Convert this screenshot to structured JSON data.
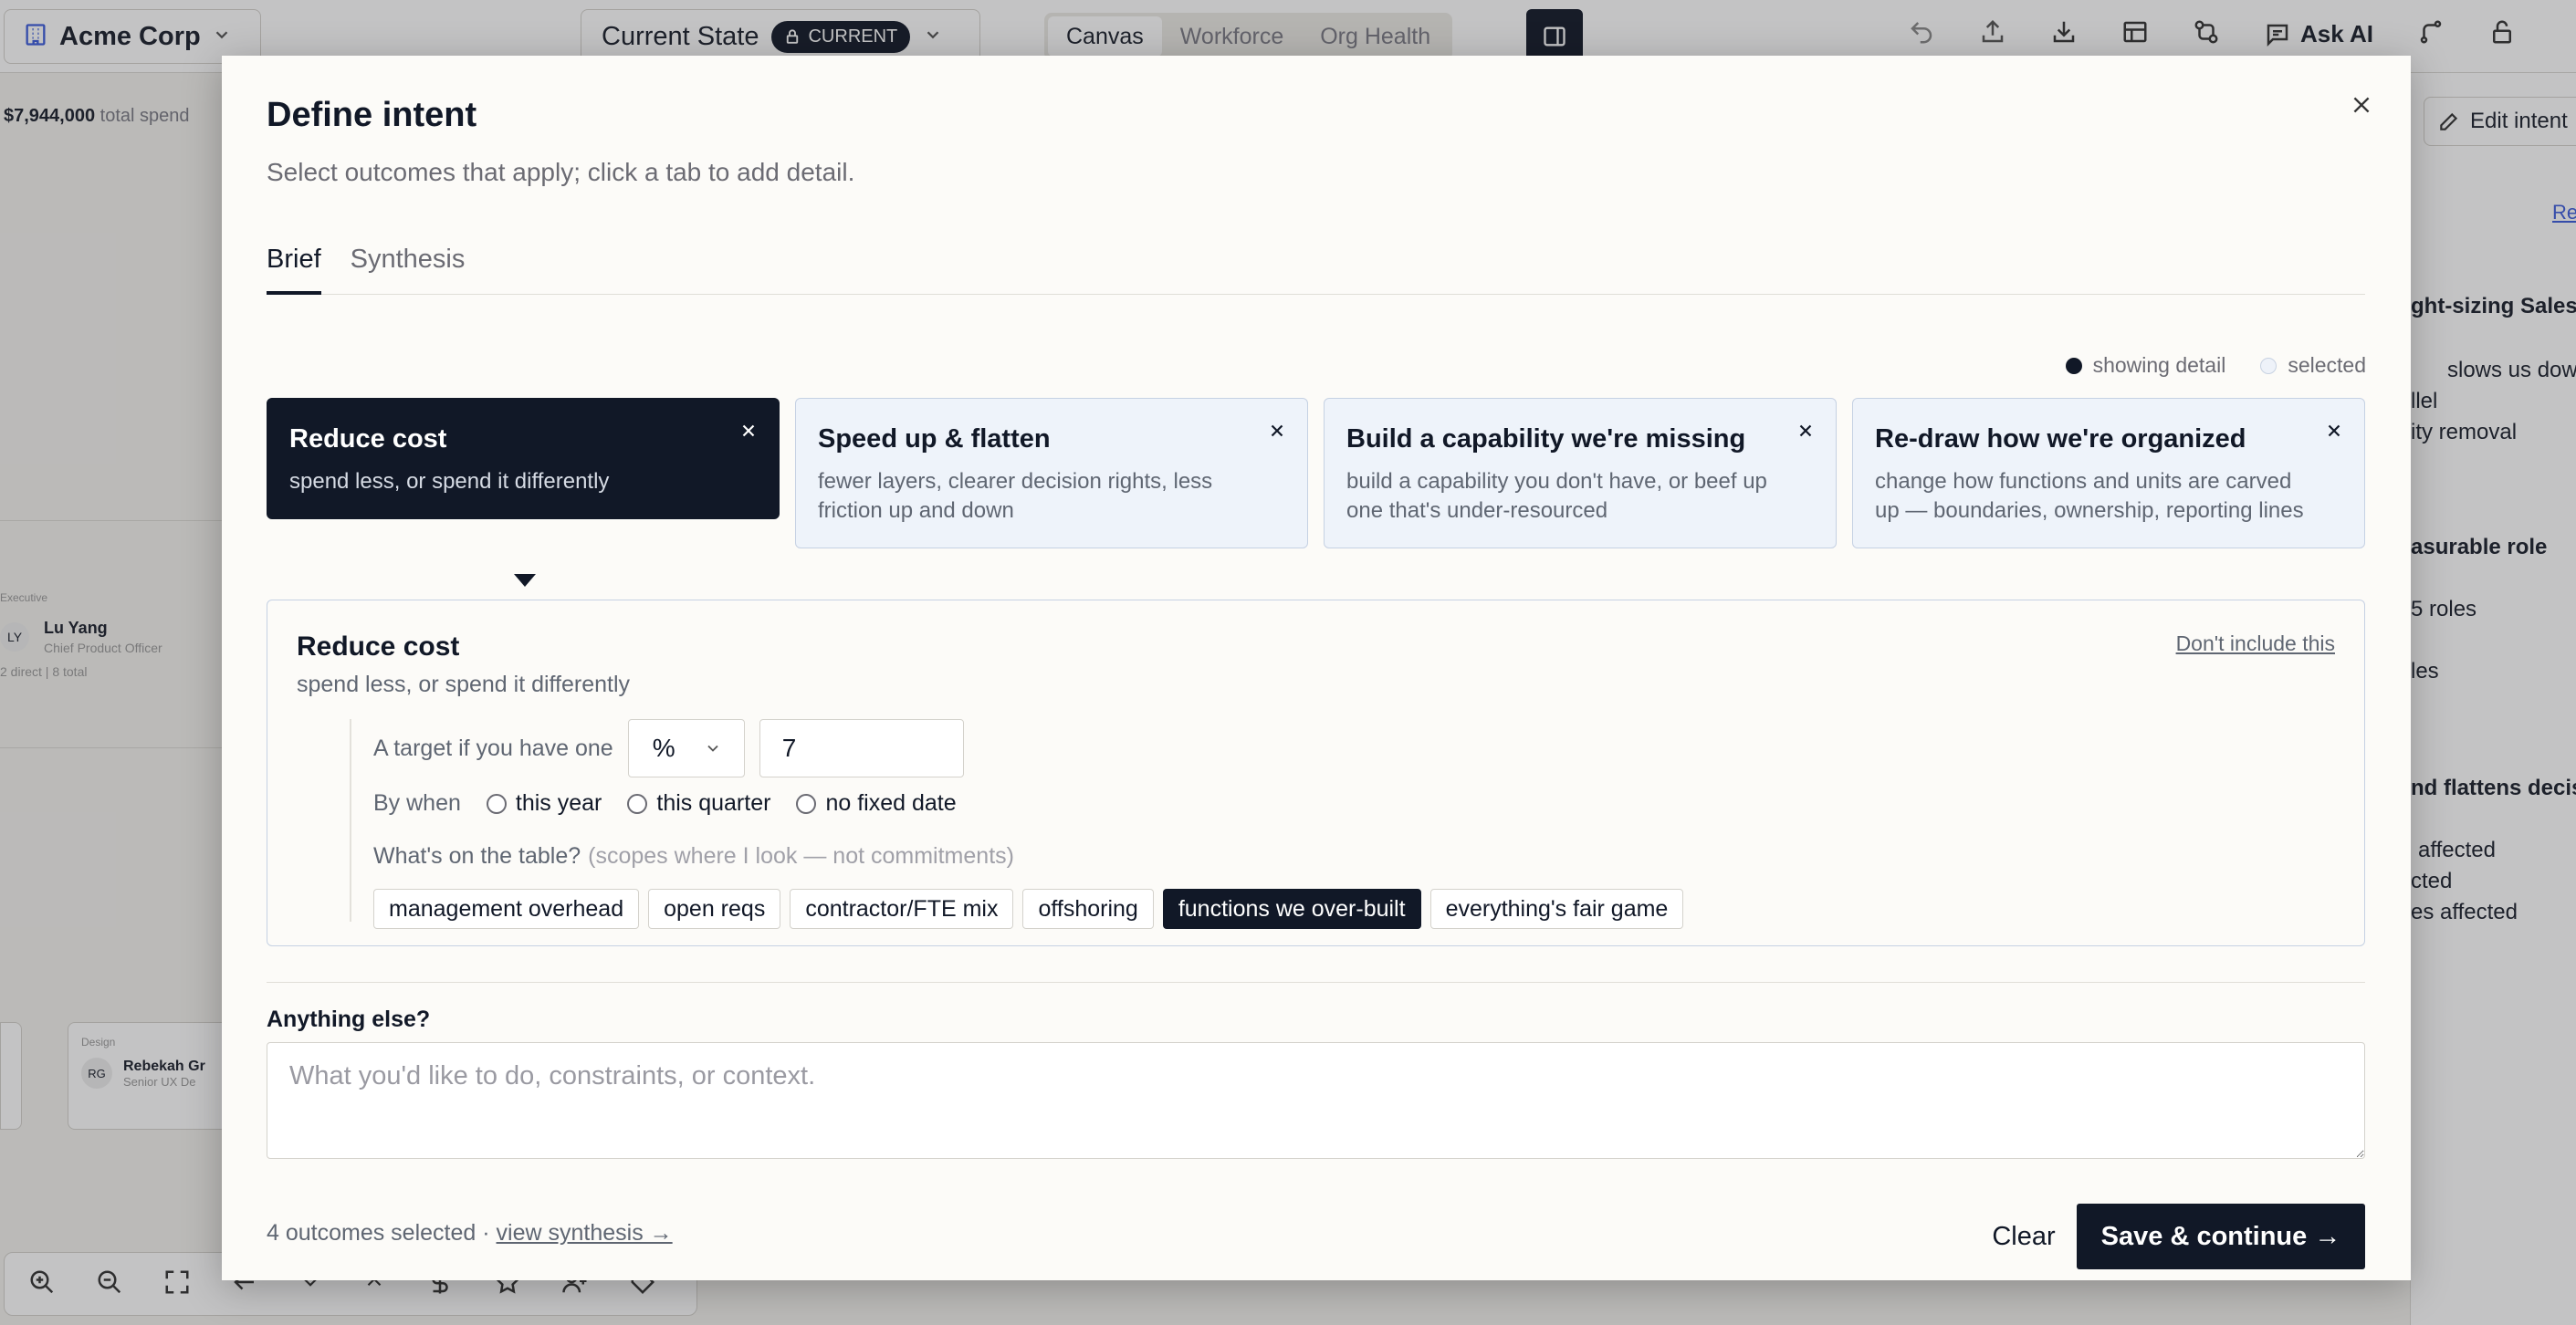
{
  "app": {
    "org_name": "Acme Corp",
    "state_label": "Current State",
    "state_badge": "CURRENT",
    "view_tabs": [
      "Canvas",
      "Workforce",
      "Org Health"
    ],
    "ask_ai_label": "Ask AI",
    "spend_value": "$7,944,000",
    "spend_label": "total spend"
  },
  "canvas": {
    "executive_label": "Executive",
    "person_initials": "LY",
    "person_name": "Lu Yang",
    "person_title": "Chief Product Officer",
    "person_reports": "2 direct | 8 total",
    "design_label": "Design",
    "design_initials": "RG",
    "design_name": "Rebekah Gr",
    "design_title": "Senior UX De"
  },
  "right_panel": {
    "edit_intent_label": "Edit intent",
    "re_label": "Re",
    "lines": [
      "ght-sizing Sales a",
      "slows us down",
      "llel",
      "ity removal",
      "asurable role",
      "5 roles",
      "les",
      "nd flattens decisi",
      "affected",
      "cted",
      "es affected"
    ]
  },
  "modal": {
    "title": "Define intent",
    "subtitle": "Select outcomes that apply; click a tab to add detail.",
    "tabs": [
      {
        "label": "Brief"
      },
      {
        "label": "Synthesis"
      }
    ],
    "legend": {
      "showing": "showing detail",
      "selected": "selected"
    },
    "outcomes": [
      {
        "title": "Reduce cost",
        "desc": "spend less, or spend it differently"
      },
      {
        "title": "Speed up & flatten",
        "desc": "fewer layers, clearer decision rights, less friction up and down"
      },
      {
        "title": "Build a capability we're missing",
        "desc": "build a capability you don't have, or beef up one that's under-resourced"
      },
      {
        "title": "Re-draw how we're organized",
        "desc": "change how functions and units are carved up — boundaries, ownership, reporting lines"
      }
    ],
    "detail": {
      "title": "Reduce cost",
      "desc": "spend less, or spend it differently",
      "exclude_label": "Don't include this",
      "target_label": "A target if you have one",
      "target_unit": "%",
      "target_value": "7",
      "by_when_label": "By when",
      "by_when_options": [
        "this year",
        "this quarter",
        "no fixed date"
      ],
      "table_label": "What's on the table?",
      "table_hint": "(scopes where I look — not commitments)",
      "chips": [
        {
          "label": "management overhead",
          "selected": false
        },
        {
          "label": "open reqs",
          "selected": false
        },
        {
          "label": "contractor/FTE mix",
          "selected": false
        },
        {
          "label": "offshoring",
          "selected": false
        },
        {
          "label": "functions we over-built",
          "selected": true
        },
        {
          "label": "everything's fair game",
          "selected": false
        }
      ]
    },
    "anything_else_label": "Anything else?",
    "anything_else_placeholder": "What you'd like to do, constraints, or context.",
    "footer": {
      "count_text": "4 outcomes selected ·",
      "view_link": "view synthesis →",
      "clear_label": "Clear",
      "save_label": "Save & continue →"
    }
  }
}
